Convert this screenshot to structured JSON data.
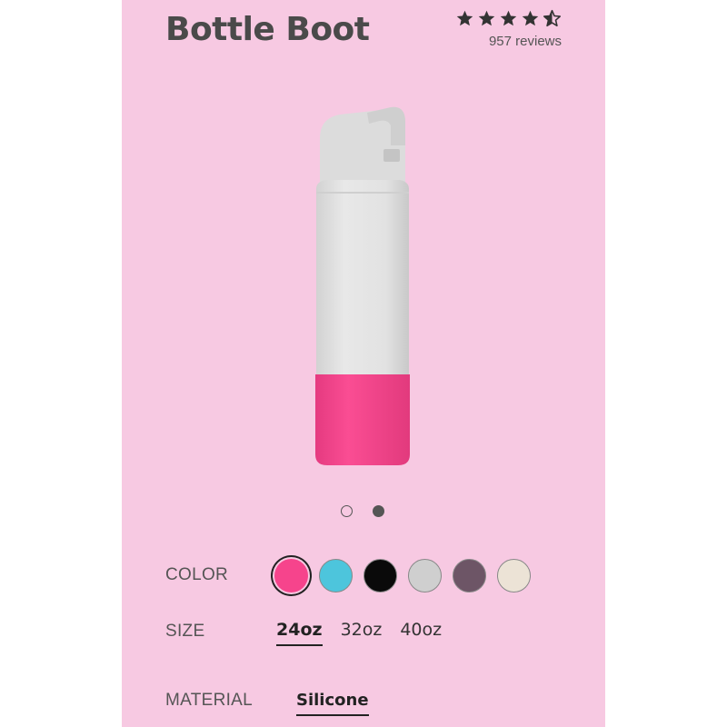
{
  "product": {
    "title": "Bottle Boot",
    "rating": 4.5,
    "reviews": "957 reviews"
  },
  "carousel": {
    "count": 2,
    "active_index": 1
  },
  "color": {
    "label": "COLOR",
    "selected_index": 0,
    "swatches": [
      "#f6448c",
      "#4dc5dc",
      "#0a0a0a",
      "#cfcfcf",
      "#6d5566",
      "#ece3d6"
    ]
  },
  "size": {
    "label": "SIZE",
    "options": [
      "24oz",
      "32oz",
      "40oz"
    ],
    "selected_index": 0
  },
  "material": {
    "label": "MATERIAL",
    "value": "Silicone"
  },
  "colors": {
    "background": "#f7c9e2",
    "bottle_body": "#e5e5e5",
    "boot": "#f6448c"
  }
}
